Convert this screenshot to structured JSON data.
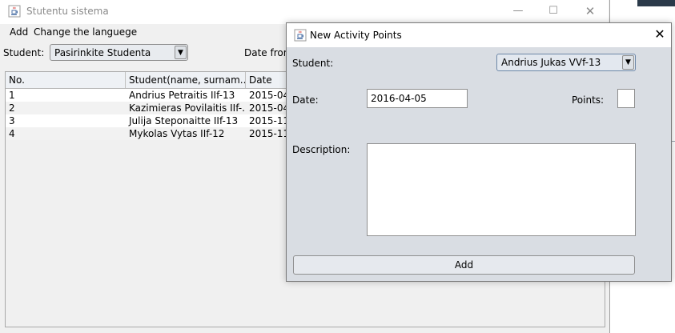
{
  "main_window": {
    "title": "Stutentu sistema",
    "menu": [
      "Add",
      "Change the languege"
    ],
    "student_label": "Student:",
    "student_select": "Pasirinkite Studenta",
    "date_from_label": "Date from",
    "table": {
      "columns": [
        "No.",
        "Student(name, surnam...",
        "Date"
      ],
      "rows": [
        [
          "1",
          "Andrius Petraitis IIf-13",
          "2015-04"
        ],
        [
          "2",
          "Kazimieras Povilaitis IIf-...",
          "2015-04"
        ],
        [
          "3",
          "Julija Steponaitte IIf-13",
          "2015-11"
        ],
        [
          "4",
          "Mykolas Vytas IIf-12",
          "2015-11"
        ]
      ]
    }
  },
  "dialog": {
    "title": "New Activity Points",
    "student_label": "Student:",
    "student_value": "Andrius Jukas VVf-13",
    "date_label": "Date:",
    "date_value": "2016-04-05",
    "points_label": "Points:",
    "points_value": "",
    "description_label": "Description:",
    "description_value": "",
    "add_button": "Add"
  },
  "icons": {
    "app": "java-coffee-cup-icon",
    "minimize": "minimize-icon",
    "maximize": "maximize-icon",
    "close": "close-icon",
    "dropdown": "chevron-down-icon"
  }
}
